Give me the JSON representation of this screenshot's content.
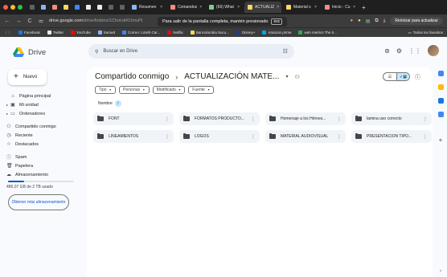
{
  "browser": {
    "tabs": [
      {
        "label": "",
        "color": "#5f6368",
        "size": "small"
      },
      {
        "label": "",
        "color": "#8ab4f8",
        "size": "small"
      },
      {
        "label": "",
        "color": "#f28b82",
        "size": "small"
      },
      {
        "label": "",
        "color": "#fdd663",
        "size": "small"
      },
      {
        "label": "",
        "color": "#4285f4",
        "size": "small"
      },
      {
        "label": "",
        "color": "#e8eaed",
        "size": "small"
      },
      {
        "label": "",
        "color": "#e8eaed",
        "size": "small"
      },
      {
        "label": "",
        "color": "#5f6368",
        "size": "small"
      },
      {
        "label": "",
        "color": "#5f6368",
        "size": "small"
      },
      {
        "label": "Resumen",
        "color": "#8ab4f8",
        "size": "mid"
      },
      {
        "label": "Comandos",
        "color": "#f28b82",
        "size": "mid"
      },
      {
        "label": "(66) What",
        "color": "#81c995",
        "size": "mid"
      },
      {
        "label": "ACTUALIZ",
        "color": "#fdd663",
        "size": "mid",
        "active": true
      },
      {
        "label": "Material s",
        "color": "#fdd663",
        "size": "mid"
      },
      {
        "label": "Inicio - Cu",
        "color": "#f28b82",
        "size": "mid"
      }
    ],
    "url_host": "drive.google.com",
    "url_path": "/drive/folders/1ChoIukKOmuPt",
    "fullscreen_msg": "Para salir de la pantalla completa, mantén presionado",
    "fullscreen_key": "esc",
    "restart_label": "Reiniciar para actualizar",
    "bookmarks": [
      {
        "label": "Facebook",
        "color": "#1877f2"
      },
      {
        "label": "Twitter",
        "color": "#e8eaed"
      },
      {
        "label": "YouTube",
        "color": "#ff0000"
      },
      {
        "label": "Samed",
        "color": "#8ab4f8"
      },
      {
        "label": "Correo: Lizeth Car...",
        "color": "#4285f4"
      },
      {
        "label": "Netflix",
        "color": "#e50914"
      },
      {
        "label": "Bancolombia Sucu...",
        "color": "#fdd663"
      },
      {
        "label": "Disney+",
        "color": "#1f3a93"
      },
      {
        "label": "Amazon prime",
        "color": "#00a8e1"
      },
      {
        "label": "web metrics The 5...",
        "color": "#34a853"
      }
    ],
    "bookmarks_all": "Todos los favoritos"
  },
  "drive": {
    "app_name": "Drive",
    "search_placeholder": "Buscar en Drive",
    "new_label": "Nuevo",
    "nav": [
      {
        "label": "Página principal",
        "icon": "home-icon",
        "glyph": "⌂"
      },
      {
        "label": "Mi unidad",
        "icon": "my-drive-icon",
        "glyph": "▣",
        "caret": true
      },
      {
        "label": "Ordenadores",
        "icon": "computer-icon",
        "glyph": "▭",
        "caret": true
      }
    ],
    "nav2": [
      {
        "label": "Compartido conmigo",
        "icon": "people-icon",
        "glyph": "⚇"
      },
      {
        "label": "Reciente",
        "icon": "clock-icon",
        "glyph": "◷"
      },
      {
        "label": "Destacados",
        "icon": "star-icon",
        "glyph": "☆"
      }
    ],
    "nav3": [
      {
        "label": "Spam",
        "icon": "spam-icon",
        "glyph": "ⓘ"
      },
      {
        "label": "Papelera",
        "icon": "trash-icon",
        "glyph": "🗑"
      },
      {
        "label": "Almacenamiento",
        "icon": "cloud-icon",
        "glyph": "☁"
      }
    ],
    "storage_text": "486,07 GB de 2 TB usado",
    "storage_fraction": 0.24,
    "get_more": "Obtener más almacenamiento",
    "breadcrumb_root": "Compartido conmigo",
    "breadcrumb_current": "ACTUALIZACIÓN MATE...",
    "filters": [
      "Tipo",
      "Personas",
      "Modificado",
      "Fuente"
    ],
    "sort_label": "Nombre",
    "folders": [
      "FONT",
      "FORMATOS PRODUCTO...",
      "Homenaje a los Héroes...",
      "lamina uso correcto",
      "LINEAMIENTOS",
      "LOGOS",
      "MATERIAL AUDIOVISUAL",
      "PRESENTACIÓN TIPO..."
    ],
    "side_panel_colors": [
      "#4285f4",
      "#fbbc04",
      "#1a73e8",
      "#4285f4"
    ]
  }
}
